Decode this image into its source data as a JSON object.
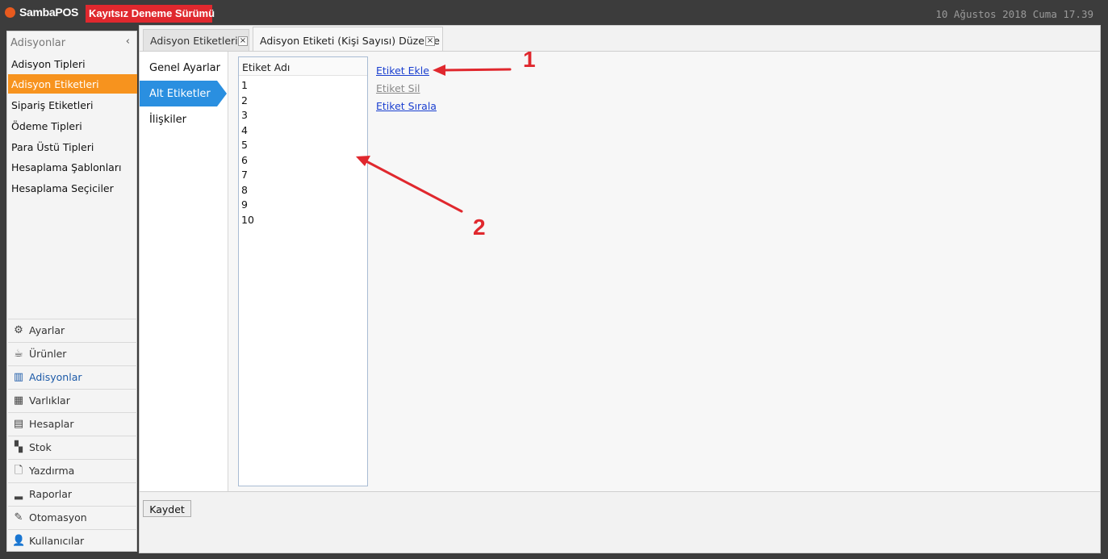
{
  "titlebar": {
    "app_name": "SambaPOS",
    "trial_label": "Kayıtsız Deneme Sürümü",
    "clock": "10 Ağustos 2018 Cuma 17.39"
  },
  "sidebar": {
    "header": "Adisyonlar",
    "collapse_glyph": "‹",
    "items": [
      {
        "label": "Adisyon Tipleri"
      },
      {
        "label": "Adisyon Etiketleri",
        "active": true
      },
      {
        "label": "Sipariş Etiketleri"
      },
      {
        "label": "Ödeme Tipleri"
      },
      {
        "label": "Para Üstü Tipleri"
      },
      {
        "label": "Hesaplama Şablonları"
      },
      {
        "label": "Hesaplama Seçiciler"
      }
    ],
    "modules": [
      {
        "label": "Ayarlar",
        "icon": "gear-icon",
        "glyph": "⚙"
      },
      {
        "label": "Ürünler",
        "icon": "coffee-icon",
        "glyph": "☕"
      },
      {
        "label": "Adisyonlar",
        "icon": "books-icon",
        "glyph": "▥",
        "active": true
      },
      {
        "label": "Varlıklar",
        "icon": "table-icon",
        "glyph": "▦"
      },
      {
        "label": "Hesaplar",
        "icon": "calculator-icon",
        "glyph": "▤"
      },
      {
        "label": "Stok",
        "icon": "boxes-icon",
        "glyph": "▚"
      },
      {
        "label": "Yazdırma",
        "icon": "document-icon",
        "glyph": "🗋"
      },
      {
        "label": "Raporlar",
        "icon": "bar-chart-icon",
        "glyph": "▂"
      },
      {
        "label": "Otomasyon",
        "icon": "pen-icon",
        "glyph": "✎"
      },
      {
        "label": "Kullanıcılar",
        "icon": "user-icon",
        "glyph": "👤"
      }
    ]
  },
  "tabs": [
    {
      "label": "Adisyon Etiketleri",
      "close": "×"
    },
    {
      "label": "Adisyon Etiketi (Kişi Sayısı) Düzenle",
      "close": "×",
      "active": true
    }
  ],
  "subnav": [
    {
      "label": "Genel Ayarlar"
    },
    {
      "label": "Alt Etiketler",
      "active": true
    },
    {
      "label": "İlişkiler"
    }
  ],
  "tag_list": {
    "header": "Etiket Adı",
    "rows": [
      "1",
      "2",
      "3",
      "4",
      "5",
      "6",
      "7",
      "8",
      "9",
      "10"
    ]
  },
  "actions": {
    "add": "Etiket Ekle",
    "delete": "Etiket Sil",
    "sort": "Etiket Sırala"
  },
  "footer": {
    "save_label": "Kaydet"
  },
  "annotations": {
    "label_1": "1",
    "label_2": "2",
    "color": "#e0282e"
  }
}
